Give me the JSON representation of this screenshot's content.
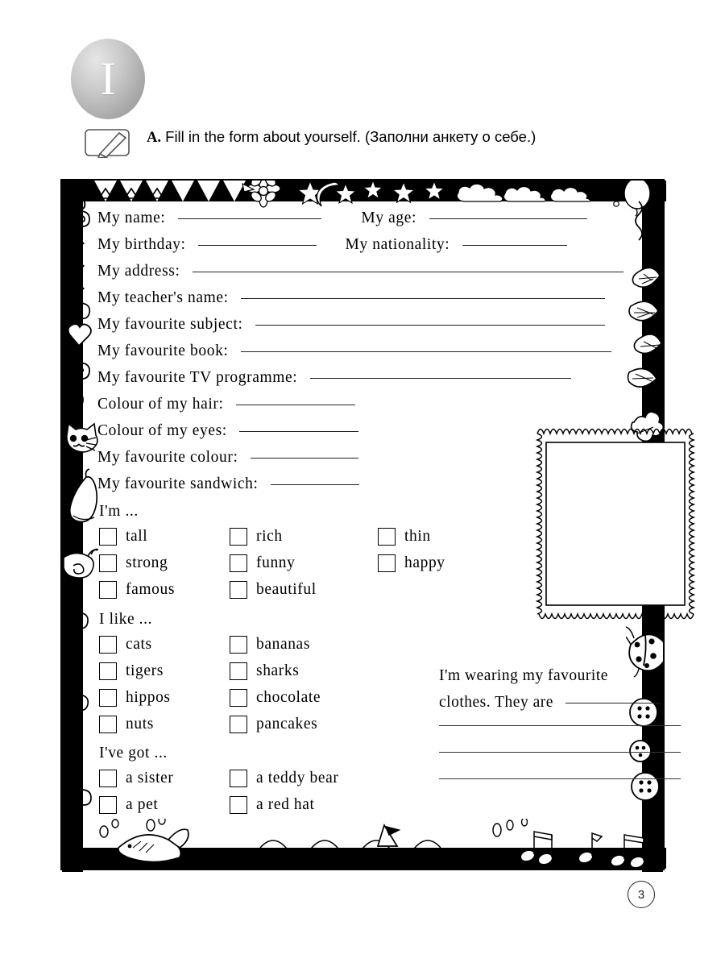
{
  "unit": {
    "number": "I"
  },
  "task": {
    "letter": "A.",
    "instruction_en": "Fill in the form about yourself.",
    "instruction_ru": "(Заполни анкету о себе.)",
    "icon": "pencil-write-icon"
  },
  "form": {
    "fields": [
      {
        "label": "My name:",
        "value": ""
      },
      {
        "label": "My age:",
        "value": ""
      },
      {
        "label": "My birthday:",
        "value": ""
      },
      {
        "label": "My nationality:",
        "value": ""
      },
      {
        "label": "My address:",
        "value": ""
      },
      {
        "label": "My teacher's name:",
        "value": ""
      },
      {
        "label": "My favourite subject:",
        "value": ""
      },
      {
        "label": "My favourite book:",
        "value": ""
      },
      {
        "label": "My favourite TV programme:",
        "value": ""
      },
      {
        "label": "Colour of my hair:",
        "value": ""
      },
      {
        "label": "Colour of my eyes:",
        "value": ""
      },
      {
        "label": "My favourite colour:",
        "value": ""
      },
      {
        "label": "My favourite sandwich:",
        "value": ""
      }
    ],
    "groups": [
      {
        "title": "I'm ...",
        "columns": [
          [
            "tall",
            "strong",
            "famous"
          ],
          [
            "rich",
            "funny",
            "beautiful"
          ],
          [
            "thin",
            "happy"
          ]
        ]
      },
      {
        "title": "I like ...",
        "columns": [
          [
            "cats",
            "tigers",
            "hippos",
            "nuts"
          ],
          [
            "bananas",
            "sharks",
            "chocolate",
            "pancakes"
          ]
        ]
      },
      {
        "title": "I've got ...",
        "columns": [
          [
            "a sister",
            "a pet"
          ],
          [
            "a teddy bear",
            "a red hat"
          ]
        ]
      }
    ],
    "wearing": {
      "line1": "I'm wearing my favourite",
      "line2": "clothes. They are"
    },
    "photo_frame_label": "photo-placeholder"
  },
  "decorations": {
    "top": [
      "bunting-triangles-icon",
      "flower-icon",
      "star-icon",
      "moon-icon",
      "cloud-icon",
      "balloon-icon"
    ],
    "left": [
      "zigzag-icon",
      "spiral-icon",
      "heart-icon",
      "cat-icon",
      "snail-icon",
      "banana-icon"
    ],
    "right": [
      "leaf-icon",
      "oak-leaf-icon",
      "ladybug-icon",
      "button-icon"
    ],
    "bottom": [
      "fish-icon",
      "wave-icon",
      "sailboat-icon",
      "music-note-icon"
    ]
  },
  "page": {
    "number": "3"
  }
}
